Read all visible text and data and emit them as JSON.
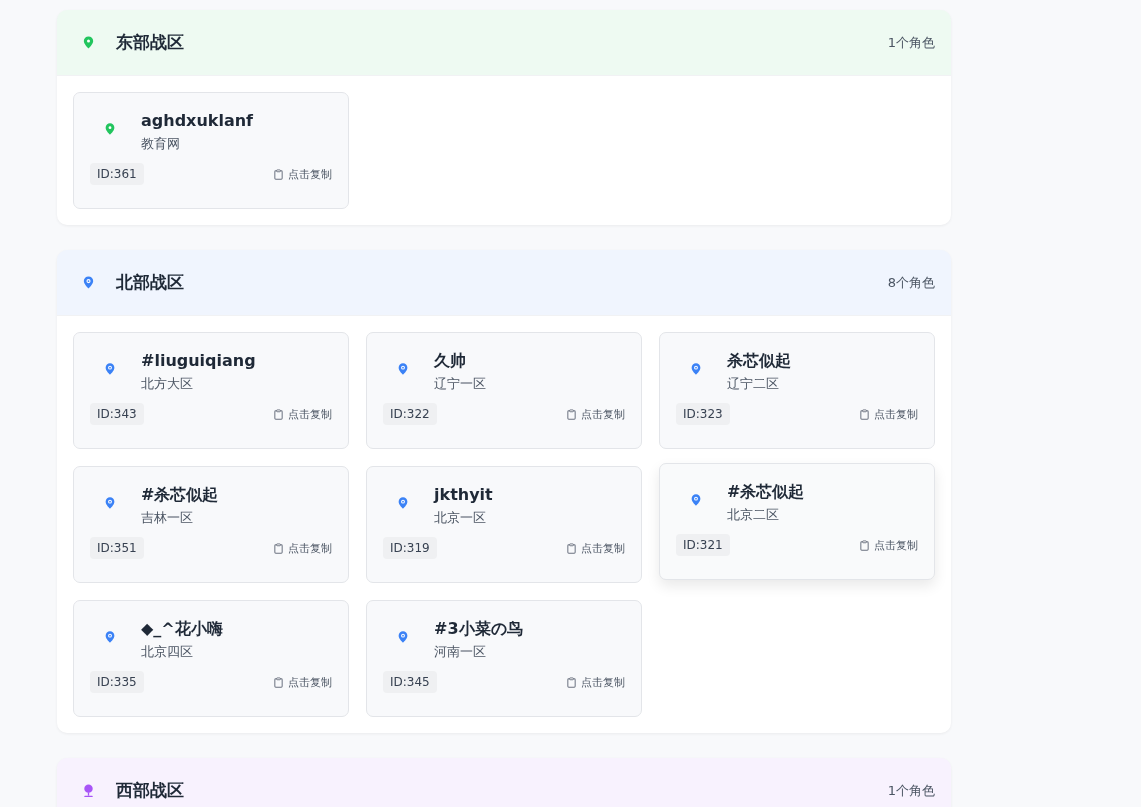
{
  "sections": [
    {
      "title": "东部战区",
      "count": "1个角色",
      "color": "#22c55e",
      "kind": "pin",
      "cards": [
        {
          "name": "aghdxuklanf",
          "server": "教育网",
          "id": "ID:361",
          "copy": "点击复制",
          "hovered": false
        }
      ]
    },
    {
      "title": "北部战区",
      "count": "8个角色",
      "color": "#3b82f6",
      "kind": "ringed",
      "cards": [
        {
          "name": "#liuguiqiang",
          "server": "北方大区",
          "id": "ID:343",
          "copy": "点击复制",
          "hovered": false
        },
        {
          "name": "久帅",
          "server": "辽宁一区",
          "id": "ID:322",
          "copy": "点击复制",
          "hovered": false
        },
        {
          "name": "杀芯似起",
          "server": "辽宁二区",
          "id": "ID:323",
          "copy": "点击复制",
          "hovered": false
        },
        {
          "name": "#杀芯似起",
          "server": "吉林一区",
          "id": "ID:351",
          "copy": "点击复制",
          "hovered": false
        },
        {
          "name": "jkthyit",
          "server": "北京一区",
          "id": "ID:319",
          "copy": "点击复制",
          "hovered": false
        },
        {
          "name": "#杀芯似起",
          "server": "北京二区",
          "id": "ID:321",
          "copy": "点击复制",
          "hovered": true
        },
        {
          "name": "◆_^花小嗨",
          "server": "北京四区",
          "id": "ID:335",
          "copy": "点击复制",
          "hovered": false
        },
        {
          "name": "#3小菜の鸟",
          "server": "河南一区",
          "id": "ID:345",
          "copy": "点击复制",
          "hovered": false
        }
      ]
    },
    {
      "title": "西部战区",
      "count": "1个角色",
      "color": "#a855f7",
      "kind": "stand"
    }
  ]
}
